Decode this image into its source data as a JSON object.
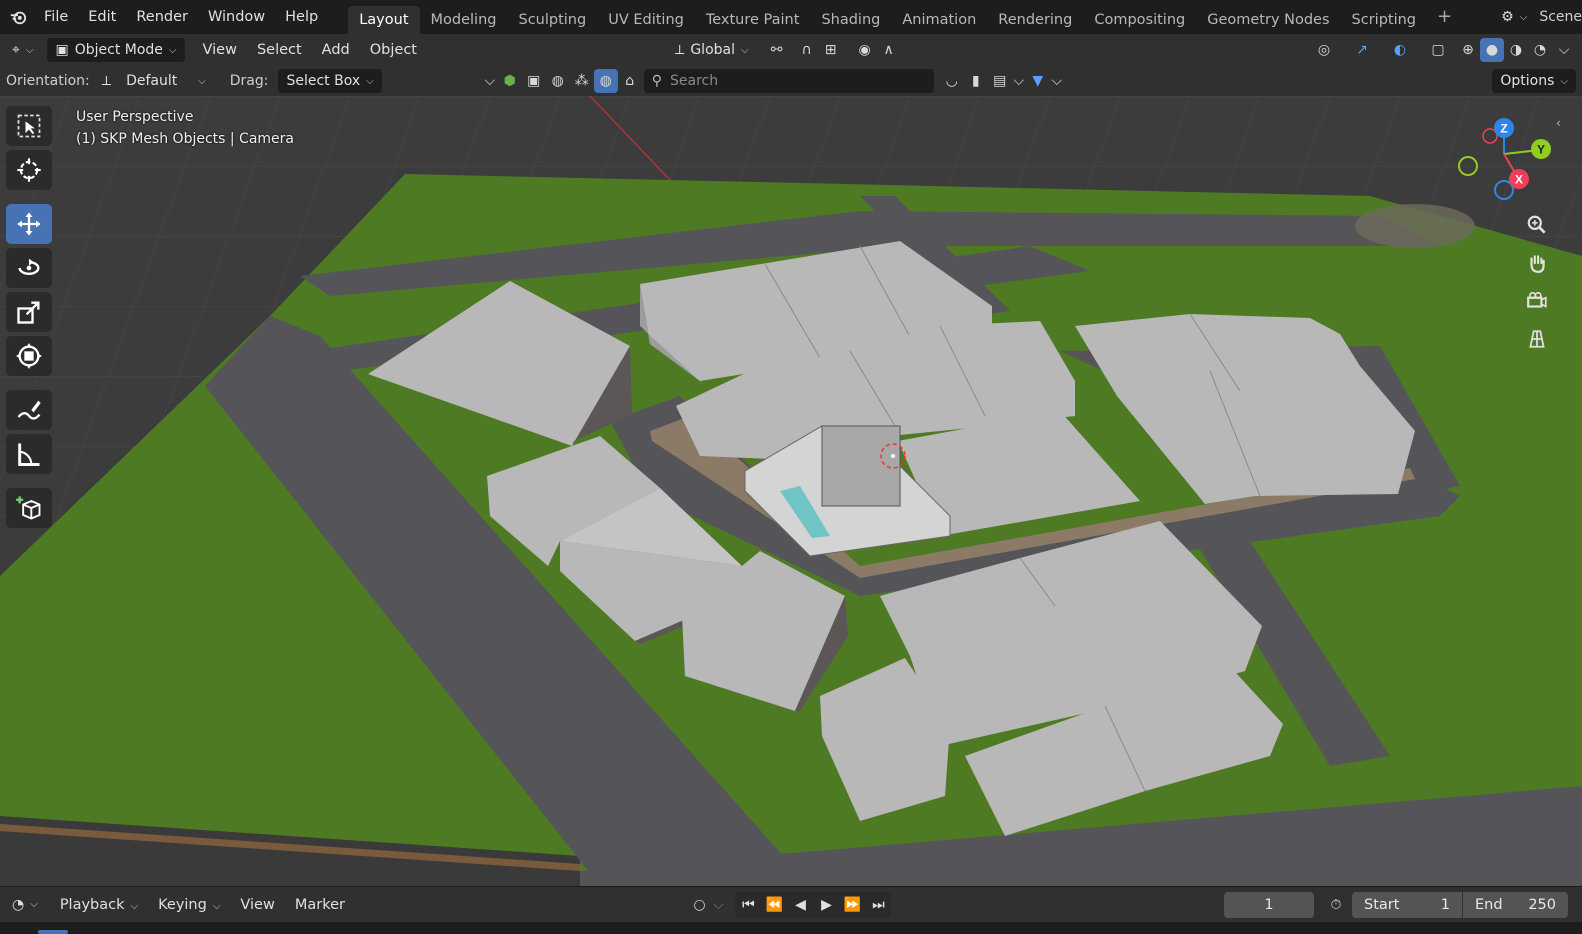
{
  "topbar": {
    "menus": [
      "File",
      "Edit",
      "Render",
      "Window",
      "Help"
    ],
    "workspaces": [
      "Layout",
      "Modeling",
      "Sculpting",
      "UV Editing",
      "Texture Paint",
      "Shading",
      "Animation",
      "Rendering",
      "Compositing",
      "Geometry Nodes",
      "Scripting"
    ],
    "active_workspace": "Layout",
    "add_tab": "+",
    "scene_label": "Scene"
  },
  "header": {
    "mode": "Object Mode",
    "menus": [
      "View",
      "Select",
      "Add",
      "Object"
    ],
    "transform_orientation": "Global"
  },
  "tool_options": {
    "orientation_label": "Orientation:",
    "orientation_value": "Default",
    "drag_label": "Drag:",
    "drag_value": "Select Box",
    "search_placeholder": "Search",
    "options_label": "Options"
  },
  "viewport": {
    "view_name": "User Perspective",
    "collection_info": "(1) SKP Mesh Objects | Camera",
    "axes": {
      "z": "Z",
      "y": "Y",
      "x": "X"
    },
    "colors": {
      "grid_bg": "#3c3c3c",
      "grass": "#4e7a24",
      "road": "#555559",
      "building": "#b8b8b8",
      "axis_x": "#ee3f55",
      "axis_y": "#8fcc24",
      "axis_z": "#2e85e8"
    }
  },
  "toolshelf": {
    "tools": [
      "select-box-icon",
      "cursor-icon",
      "move-icon",
      "rotate-icon",
      "scale-icon",
      "transform-icon",
      "annotate-icon",
      "measure-icon",
      "add-cube-icon"
    ],
    "active_tool": "move-icon"
  },
  "timeline": {
    "menus": [
      "Playback",
      "Keying",
      "View",
      "Marker"
    ],
    "current_frame": "1",
    "start_label": "Start",
    "start_value": "1",
    "end_label": "End",
    "end_value": "250"
  }
}
